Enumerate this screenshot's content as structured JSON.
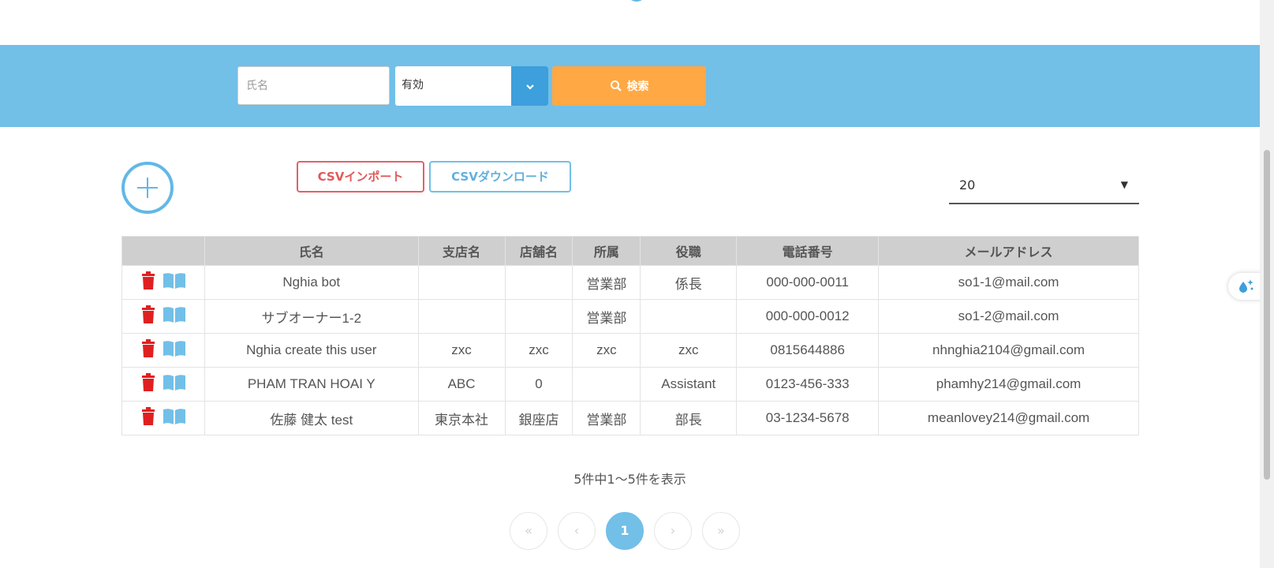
{
  "search": {
    "name_placeholder": "氏名",
    "status_value": "有効",
    "button_label": "検索"
  },
  "actions": {
    "csv_import": "CSVインポート",
    "csv_download": "CSVダウンロード"
  },
  "page_size": {
    "value": "20"
  },
  "table": {
    "headers": [
      "",
      "氏名",
      "支店名",
      "店舗名",
      "所属",
      "役職",
      "電話番号",
      "メールアドレス"
    ],
    "rows": [
      [
        "Nghia bot",
        "",
        "",
        "営業部",
        "係長",
        "000-000-0011",
        "so1-1@mail.com"
      ],
      [
        "サブオーナー1-2",
        "",
        "",
        "営業部",
        "",
        "000-000-0012",
        "so1-2@mail.com"
      ],
      [
        "Nghia create this user",
        "zxc",
        "zxc",
        "zxc",
        "zxc",
        "0815644886",
        "nhnghia2104@gmail.com"
      ],
      [
        "PHAM TRAN HOAI Y",
        "ABC",
        "0",
        "",
        "Assistant",
        "0123-456-333",
        "phamhy214@gmail.com"
      ],
      [
        "佐藤 健太 test",
        "東京本社",
        "銀座店",
        "営業部",
        "部長",
        "03-1234-5678",
        "meanlovey214@gmail.com"
      ]
    ]
  },
  "summary": "5件中1〜5件を表示",
  "pagination": {
    "first": "«",
    "prev": "‹",
    "current": "1",
    "next": "›",
    "last": "»"
  },
  "colors": {
    "accent": "#72bfe8",
    "search_button": "#ffa844",
    "delete_icon": "#e02020",
    "detail_icon": "#72bfe8"
  }
}
